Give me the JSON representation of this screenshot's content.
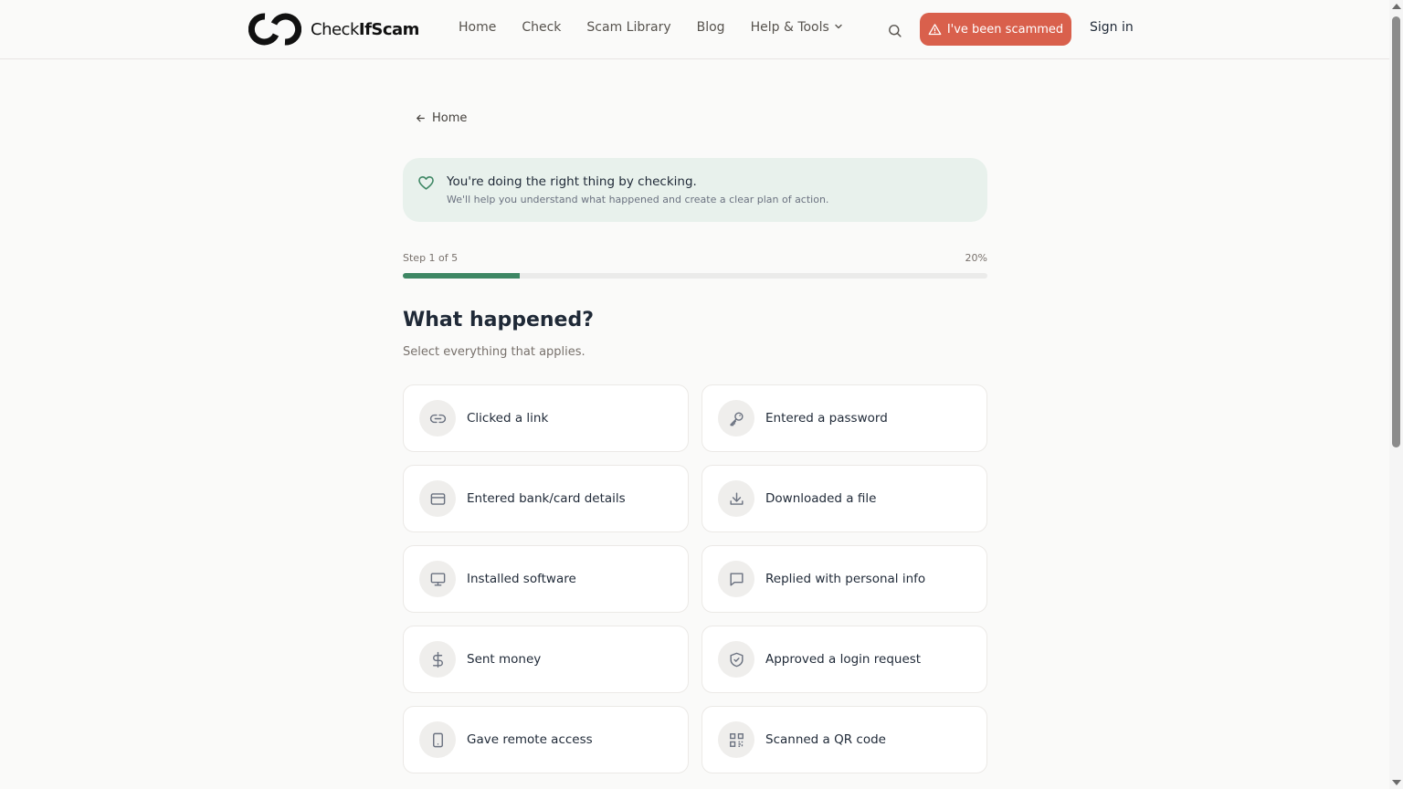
{
  "brand": {
    "name_regular": "Check",
    "name_bold": "IfScam"
  },
  "nav": {
    "items": [
      {
        "label": "Home"
      },
      {
        "label": "Check"
      },
      {
        "label": "Scam Library"
      },
      {
        "label": "Blog"
      },
      {
        "label": "Help & Tools"
      }
    ],
    "scam_button": "I've been scammed",
    "sign_in": "Sign in"
  },
  "breadcrumb": {
    "back_label": "Home"
  },
  "banner": {
    "title": "You're doing the right thing by checking.",
    "subtitle": "We'll help you understand what happened and create a clear plan of action."
  },
  "progress": {
    "step_label": "Step 1 of 5",
    "percent_label": "20%",
    "fraction": 0.2
  },
  "question": {
    "title": "What happened?",
    "subtitle": "Select everything that applies."
  },
  "options": [
    {
      "label": "Clicked a link",
      "icon": "link-icon"
    },
    {
      "label": "Entered a password",
      "icon": "key-icon"
    },
    {
      "label": "Entered bank/card details",
      "icon": "credit-card-icon"
    },
    {
      "label": "Downloaded a file",
      "icon": "download-icon"
    },
    {
      "label": "Installed software",
      "icon": "monitor-icon"
    },
    {
      "label": "Replied with personal info",
      "icon": "message-icon"
    },
    {
      "label": "Sent money",
      "icon": "dollar-icon"
    },
    {
      "label": "Approved a login request",
      "icon": "shield-check-icon"
    },
    {
      "label": "Gave remote access",
      "icon": "tablet-icon"
    },
    {
      "label": "Scanned a QR code",
      "icon": "qr-code-icon"
    }
  ],
  "colors": {
    "accent": "#3e8764",
    "danger": "#d9604c",
    "banner_bg": "#e8f1ec"
  }
}
